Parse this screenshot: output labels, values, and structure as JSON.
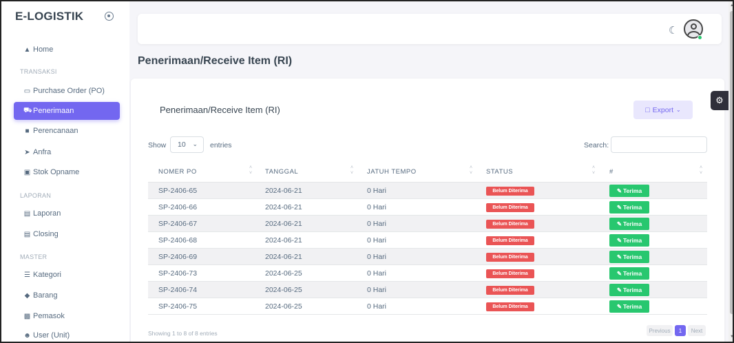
{
  "brand": {
    "name": "E-LOGISTIK"
  },
  "sidebar": {
    "items": [
      {
        "label": "Home",
        "icon": "home-icon"
      },
      {
        "header": "TRANSAKSI"
      },
      {
        "label": "Purchase Order (PO)",
        "icon": "inbox-icon"
      },
      {
        "label": "Penerimaan",
        "icon": "truck-icon",
        "active": true
      },
      {
        "label": "Perencanaan",
        "icon": "sticky-note-icon"
      },
      {
        "label": "Anfra",
        "icon": "send-icon"
      },
      {
        "label": "Stok Opname",
        "icon": "box-icon"
      },
      {
        "header": "LAPORAN"
      },
      {
        "label": "Laporan",
        "icon": "report-icon"
      },
      {
        "label": "Closing",
        "icon": "calculator-icon"
      },
      {
        "header": "MASTER"
      },
      {
        "label": "Kategori",
        "icon": "list-icon"
      },
      {
        "label": "Barang",
        "icon": "tag-icon"
      },
      {
        "label": "Pemasok",
        "icon": "store-icon"
      },
      {
        "label": "User (Unit)",
        "icon": "user-icon"
      }
    ]
  },
  "page": {
    "title": "Penerimaan/Receive Item (RI)"
  },
  "card": {
    "title": "Penerimaan/Receive Item (RI)",
    "export_label": "Export",
    "show_label": "Show",
    "show_value": "10",
    "entries_label": "entries",
    "search_label": "Search:",
    "search_value": ""
  },
  "table": {
    "headers": [
      "NOMER PO",
      "TANGGAL",
      "JATUH TEMPO",
      "STATUS",
      "#"
    ],
    "rows": [
      {
        "po": "SP-2406-65",
        "date": "2024-06-21",
        "due": "0 Hari",
        "status": "Belum Diterima",
        "action": "Terima"
      },
      {
        "po": "SP-2406-66",
        "date": "2024-06-21",
        "due": "0 Hari",
        "status": "Belum Diterima",
        "action": "Terima"
      },
      {
        "po": "SP-2406-67",
        "date": "2024-06-21",
        "due": "0 Hari",
        "status": "Belum Diterima",
        "action": "Terima"
      },
      {
        "po": "SP-2406-68",
        "date": "2024-06-21",
        "due": "0 Hari",
        "status": "Belum Diterima",
        "action": "Terima"
      },
      {
        "po": "SP-2406-69",
        "date": "2024-06-21",
        "due": "0 Hari",
        "status": "Belum Diterima",
        "action": "Terima"
      },
      {
        "po": "SP-2406-73",
        "date": "2024-06-25",
        "due": "0 Hari",
        "status": "Belum Diterima",
        "action": "Terima"
      },
      {
        "po": "SP-2406-74",
        "date": "2024-06-25",
        "due": "0 Hari",
        "status": "Belum Diterima",
        "action": "Terima"
      },
      {
        "po": "SP-2406-75",
        "date": "2024-06-25",
        "due": "0 Hari",
        "status": "Belum Diterima",
        "action": "Terima"
      }
    ]
  },
  "footer": {
    "showing": "Showing 1 to 8 of 8 entries",
    "prev_label": "Previous",
    "current_page": "1",
    "next_label": "Next"
  },
  "colors": {
    "accent": "#7367f0",
    "success": "#28c76f",
    "danger": "#ea5455"
  }
}
